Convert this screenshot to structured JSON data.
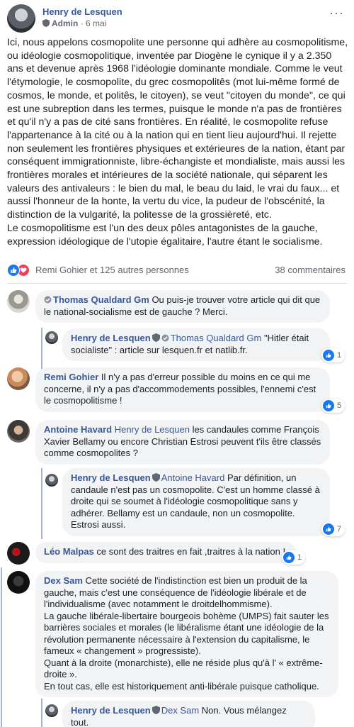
{
  "post": {
    "author": "Henry de Lesquen",
    "role": "Admin",
    "time": "6 mai",
    "menu": "···",
    "paragraph1": "Ici, nous appelons cosmopolite une personne qui adhère au cosmopolitisme, ou idéologie cosmopolitique, inventée par Diogène le cynique il y a 2.350 ans et devenue après 1968 l'idéologie dominante mondiale. Comme le veut l'étymologie, le cosmopolite, du grec cosmopolitês (mot lui-même formé de cosmos, le monde, et politês, le citoyen), se veut \"citoyen du monde\", ce qui est une subreption dans les termes, puisque le monde n'a pas de frontières et qu'il n'y a pas de cité sans frontières. En réalité, le cosmopolite refuse l'appartenance à la cité ou à la nation qui en tient lieu aujourd'hui. Il rejette non seulement les frontières physiques et extérieures de la nation, étant par conséquent immigrationniste, libre-échangiste et mondialiste, mais aussi les frontières morales et intérieures de la société nationale, qui séparent les valeurs des antivaleurs : le bien du mal, le beau du laid, le vrai du faux... et aussi l'honneur de la honte, la vertu du vice, la pudeur de l'obscénité, la distinction de la vulgarité, la politesse de la grossièreté, etc.",
    "paragraph2": "Le cosmopolitisme est l'un des deux pôles antagonistes de la gauche, expression idéologique de l'utopie égalitaire, l'autre étant le socialisme.",
    "reactions_label": "Remi Gohier et 125 autres personnes",
    "comments_count": "38 commentaires"
  },
  "comments": [
    {
      "name": "Thomas Qualdard Gm",
      "text": "Ou puis-je trouver votre article qui dit que le national-socialisme est de gauche ? Merci."
    },
    {
      "name": "Henry de Lesquen",
      "tag": "Thomas Qualdard Gm",
      "text": "\"Hitler était socialiste\" : article sur lesquen.fr et natlib.fr.",
      "likes": "1"
    },
    {
      "name": "Remi Gohier",
      "text": "Il n'y a pas d'erreur possible du moins en ce qui me concerne, il n'y a pas d'accommodements possibles, l'ennemi c'est le cosmopolitisme !",
      "likes": "5"
    },
    {
      "name": "Antoine Havard",
      "tag": "Henry de Lesquen",
      "text": "les candaules comme François Xavier Bellamy ou encore Christian Estrosi peuvent t'ils être classés comme cosmopolites ?"
    },
    {
      "name": "Henry de Lesquen",
      "tag": "Antoine Havard",
      "text": "Par définition, un candaule n'est pas un cosmopolite. C'est un homme classé à droite qui se soumet à l'idéologie cosmopolitique sans y adhérer. Bellamy est un candaule, non un cosmopolite. Estrosi aussi.",
      "likes": "7"
    },
    {
      "name": "Léo Malpas",
      "text": "ce sont des traitres en fait ,traitres à la nation !",
      "likes": "1"
    },
    {
      "name": "Dex Sam",
      "p1": "Cette société de l'indistinction est bien un produit de la gauche, mais c'est une conséquence de l'idéologie libérale et de l'individualisme (avec notamment le droitdelhommisme).",
      "p2": "La gauche libérale-libertaire bourgeois bohème (UMPS) fait sauter les barrières sociales et morales (le libéralisme étant une idéologie de la révolution permanente nécessaire à l'extension du capitalisme, le fameux « changement » progressiste).",
      "p3": "Quant à la droite (monarchiste), elle ne réside plus qu'à l' « extrême-droite ».",
      "p4": "En tout cas, elle est historiquement anti-libérale puisque catholique."
    },
    {
      "name": "Henry de Lesquen",
      "tag": "Dex Sam",
      "text": "Non. Vous mélangez tout."
    }
  ],
  "colors": {
    "link": "#385898",
    "like": "#1877f2",
    "love": "#f33e58",
    "bubble": "#f2f3f5",
    "thread": "#9fb3d6"
  }
}
